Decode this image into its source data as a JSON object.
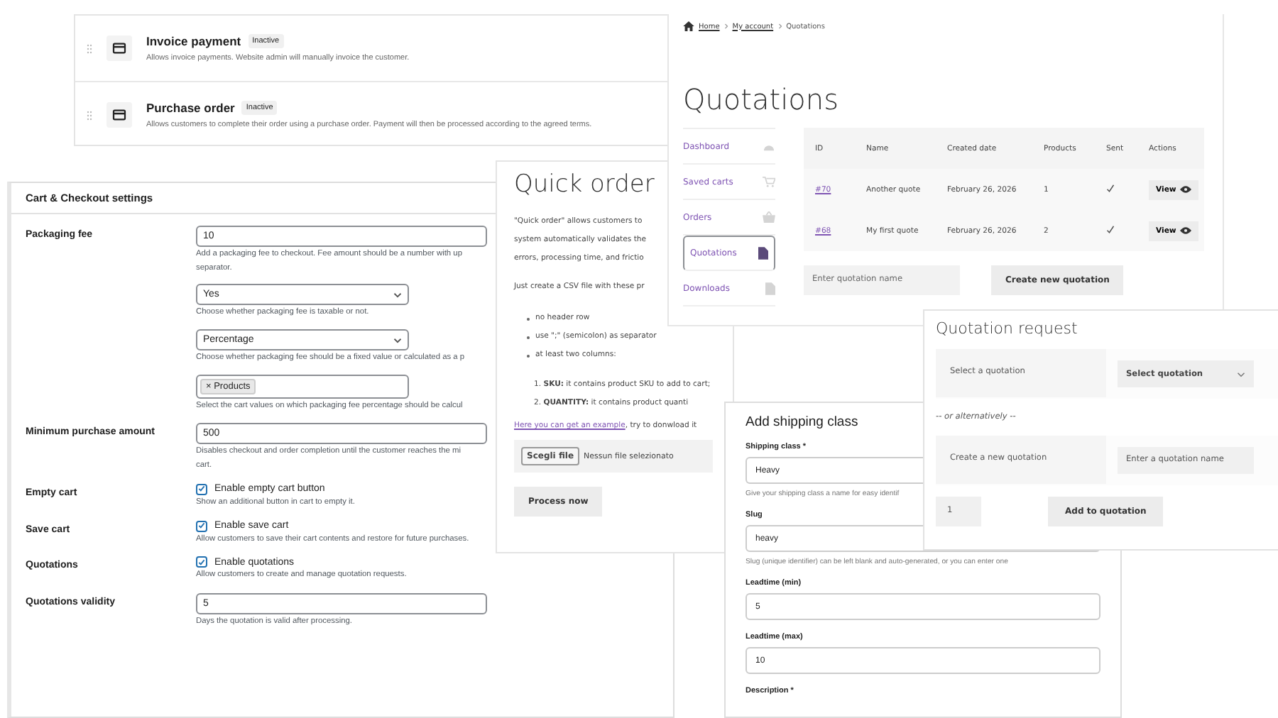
{
  "payment_methods": [
    {
      "name": "Invoice payment",
      "status": "Inactive",
      "description": "Allows invoice payments. Website admin will manually invoice the customer."
    },
    {
      "name": "Purchase order",
      "status": "Inactive",
      "description": "Allows customers to complete their order using a purchase order. Payment will then be processed according to the agreed terms."
    }
  ],
  "settings": {
    "title": "Cart & Checkout settings",
    "rows": [
      {
        "label": "Packaging fee",
        "fields": [
          {
            "kind": "text",
            "value": "10",
            "description": [
              "Add a packaging fee to checkout. Fee amount should be a number with up",
              "separator."
            ]
          },
          {
            "kind": "select",
            "value": "Yes",
            "description": [
              "Choose whether packaging fee is taxable or not."
            ]
          },
          {
            "kind": "select",
            "value": "Percentage",
            "description": [
              "Choose whether packaging fee should be a fixed value or calculated as a p"
            ]
          },
          {
            "kind": "tags",
            "tags": [
              "× Products"
            ],
            "description": [
              "Select the cart values on which packaging fee percentage should be calcul"
            ]
          }
        ]
      },
      {
        "label": "Minimum purchase amount",
        "fields": [
          {
            "kind": "text",
            "value": "500",
            "description": [
              "Disables checkout and order completion until the customer reaches the mi",
              "cart."
            ]
          }
        ]
      },
      {
        "label": "Empty cart",
        "fields": [
          {
            "kind": "checkbox",
            "checked": true,
            "value": "Enable empty cart button",
            "description": [
              "Show an additional button in cart to empty it."
            ]
          }
        ]
      },
      {
        "label": "Save cart",
        "fields": [
          {
            "kind": "checkbox",
            "checked": true,
            "value": "Enable save cart",
            "description": [
              "Allow customers to save their cart contents and restore for future purchases."
            ]
          }
        ]
      },
      {
        "label": "Quotations",
        "fields": [
          {
            "kind": "checkbox",
            "checked": true,
            "value": "Enable quotations",
            "description": [
              "Allow customers to create and manage quotation requests."
            ]
          }
        ]
      },
      {
        "label": "Quotations validity",
        "fields": [
          {
            "kind": "text",
            "value": "5",
            "description": [
              "Days the quotation is valid after processing."
            ]
          }
        ]
      }
    ]
  },
  "quick_order": {
    "title": "Quick order",
    "intro_lines": [
      "\"Quick order\" allows customers to",
      "system automatically validates the",
      "errors, processing time, and frictio"
    ],
    "instructions": "Just create a CSV file with these pr",
    "bullets": [
      "no header row",
      "use \";\" (semicolon) as separator",
      "at least two columns:"
    ],
    "steps": [
      "1. **SKU:** it contains product SKU to add to cart;",
      "2. **QUANTITY:** it contains product quanti"
    ],
    "example_link": "Here you can get an example",
    "example_rest": ", try to donwload it",
    "file_button": "Scegli file",
    "file_status": "Nessun file selezionato",
    "submit": "Process now"
  },
  "account": {
    "breadcrumb": [
      "Home",
      "My account",
      "Quotations"
    ],
    "title": "Quotations",
    "nav": [
      {
        "label": "Dashboard",
        "selected": false
      },
      {
        "label": "Saved carts",
        "selected": false
      },
      {
        "label": "Orders",
        "selected": false
      },
      {
        "label": "Quotations",
        "selected": true
      },
      {
        "label": "Downloads",
        "selected": false
      }
    ],
    "table": {
      "columns": [
        "ID",
        "Name",
        "Created date",
        "Products",
        "Sent",
        "Actions"
      ],
      "rows": [
        {
          "id": "#70",
          "name": "Another quote",
          "date": "February 26, 2026",
          "products": "1",
          "sent": true,
          "action": "View"
        },
        {
          "id": "#68",
          "name": "My first quote",
          "date": "February 26, 2026",
          "products": "2",
          "sent": true,
          "action": "View"
        }
      ]
    },
    "new_quotation": {
      "placeholder": "Enter quotation name",
      "button": "Create new quotation"
    }
  },
  "quotation_request": {
    "title": "Quotation request",
    "select_label": "Select a quotation",
    "select_value": "Select quotation",
    "separator": "-- or alternatively --",
    "create_label": "Create a new quotation",
    "name_placeholder": "Enter a quotation name",
    "quantity": "1",
    "button": "Add to quotation"
  },
  "shipping_class": {
    "title": "Add shipping class",
    "fields": [
      {
        "label": "Shipping class *",
        "value": "Heavy",
        "help": "Give your shipping class a name for easy identif"
      },
      {
        "label": "Slug",
        "value": "heavy",
        "help": "Slug (unique identifier) can be left blank and auto-generated, or you can enter one"
      },
      {
        "label": "Leadtime (min)",
        "value": "5"
      },
      {
        "label": "Leadtime (max)",
        "value": "10"
      },
      {
        "label": "Description *"
      }
    ]
  }
}
